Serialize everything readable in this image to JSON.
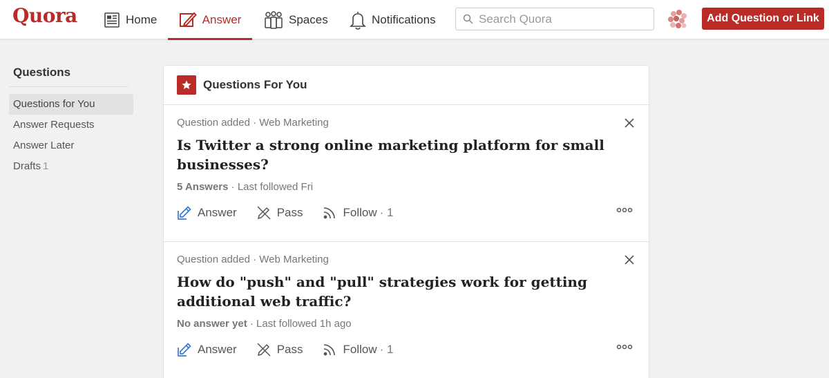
{
  "header": {
    "logo": "Quora",
    "nav": {
      "home": "Home",
      "answer": "Answer",
      "spaces": "Spaces",
      "notifications": "Notifications"
    },
    "search_placeholder": "Search Quora",
    "add_button": "Add Question or Link"
  },
  "sidebar": {
    "title": "Questions",
    "items": [
      {
        "label": "Questions for You",
        "active": true
      },
      {
        "label": "Answer Requests"
      },
      {
        "label": "Answer Later"
      },
      {
        "label": "Drafts",
        "count": "1"
      }
    ]
  },
  "feed": {
    "title": "Questions For You",
    "questions": [
      {
        "meta": "Question added · Web Marketing",
        "title": "Is Twitter a strong online marketing platform for small businesses?",
        "answers": "5 Answers",
        "followed": " · Last followed Fri",
        "answer_label": "Answer",
        "pass_label": "Pass",
        "follow_label": "Follow",
        "follow_count": "· 1"
      },
      {
        "meta": "Question added · Web Marketing",
        "title": "How do \"push\" and \"pull\" strategies work for getting additional web traffic?",
        "answers": "No answer yet",
        "followed": " · Last followed 1h ago",
        "answer_label": "Answer",
        "pass_label": "Pass",
        "follow_label": "Follow",
        "follow_count": "· 1"
      }
    ]
  },
  "colors": {
    "brand": "#b92b27",
    "answer_icon": "#3e78d4"
  }
}
